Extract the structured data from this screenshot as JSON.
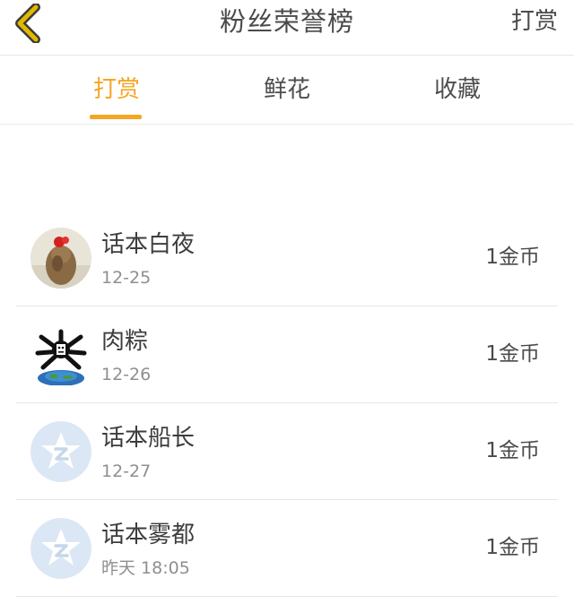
{
  "header": {
    "title": "粉丝荣誉榜",
    "action_label": "打赏",
    "back_icon": "chevron-left-icon",
    "back_icon_color": "#e2b800"
  },
  "tabs": [
    {
      "label": "打赏",
      "active": true
    },
    {
      "label": "鲜花",
      "active": false
    },
    {
      "label": "收藏",
      "active": false
    }
  ],
  "accent_color": "#f5a623",
  "list": [
    {
      "name": "话本白夜",
      "time": "12-25",
      "amount": "1金币",
      "avatar": "photo-avatar"
    },
    {
      "name": "肉粽",
      "time": "12-26",
      "amount": "1金币",
      "avatar": "globe-cartoon-avatar"
    },
    {
      "name": "话本船长",
      "time": "12-27",
      "amount": "1金币",
      "avatar": "default-qq-avatar"
    },
    {
      "name": "话本雾都",
      "time": "昨天 18:05",
      "amount": "1金币",
      "avatar": "default-qq-avatar"
    }
  ]
}
